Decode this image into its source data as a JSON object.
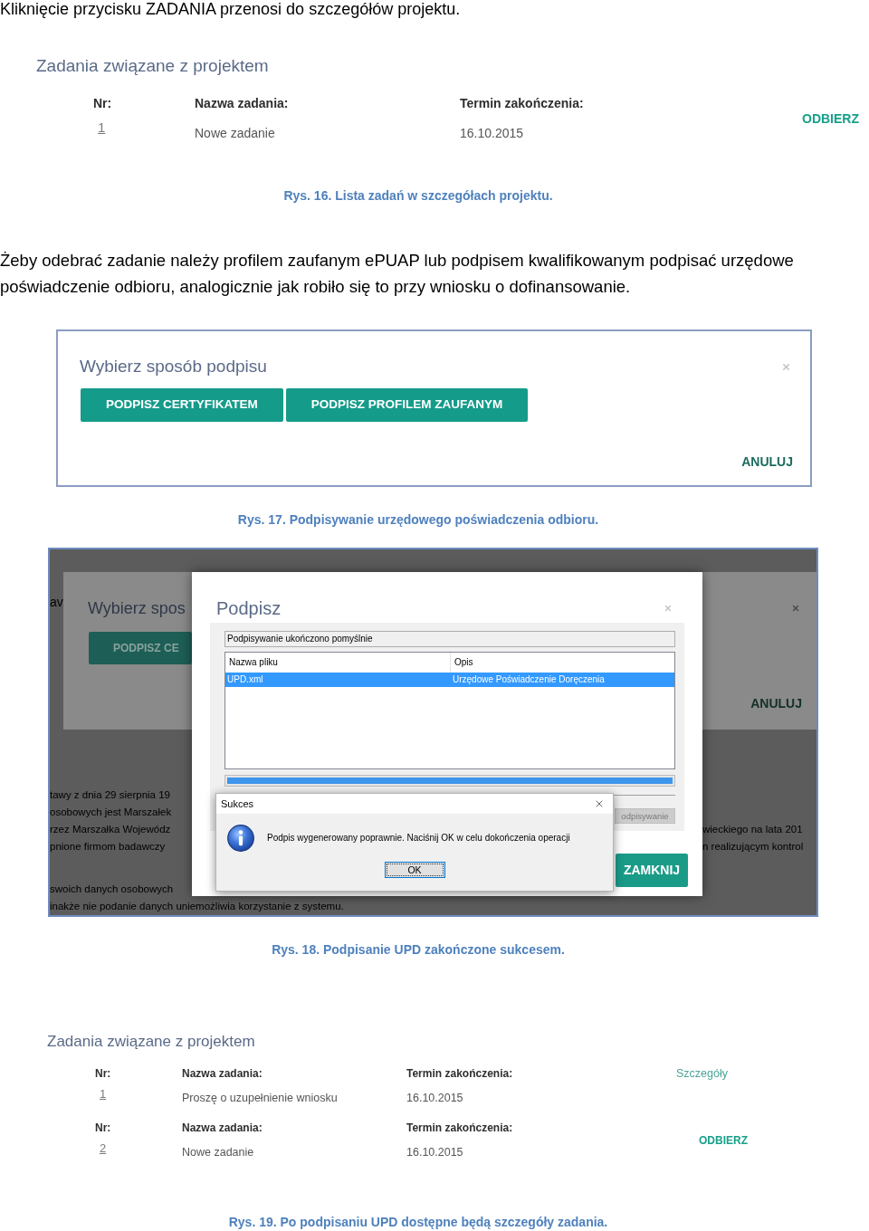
{
  "intro": "Kliknięcie przycisku ZADANIA przenosi do szczegółów projektu.",
  "figure_16": {
    "task_list": {
      "title": "Zadania związane z projektem",
      "tasks": [
        {
          "number_label": "Nr:",
          "number": "1",
          "name_label": "Nazwa zadania:",
          "name": "Nowe zadanie",
          "deadline_label": "Termin zakończenia:",
          "deadline": "16.10.2015",
          "action": {
            "kind": "button",
            "label": "ODBIERZ"
          }
        }
      ]
    },
    "caption": "Rys. 16. Lista zadań w szczegółach projektu."
  },
  "paragraph": "Żeby odebrać zadanie należy profilem zaufanym ePUAP lub podpisem kwalifikowanym podpisać urzędowe poświadczenie odbioru, analogicznie jak robiło się to przy wniosku o dofinansowanie.",
  "figure_17": {
    "dialog": {
      "title": "Wybierz sposób podpisu",
      "buttons": [
        "PODPISZ CERTYFIKATEM",
        "PODPISZ PROFILEM ZAUFANYM"
      ],
      "cancel": "ANULUJ"
    },
    "caption": "Rys. 17. Podpisywanie urzędowego poświadczenia odbioru."
  },
  "figure_18": {
    "background": {
      "edge_text": "av",
      "dimmed_dialog": {
        "title": "Wybierz spos",
        "button": "PODPISZ CE",
        "cancel": "ANULUJ"
      },
      "paragraphs": [
        {
          "lines": [
            {
              "left": "tawy z dnia 29 sierpnia 19"
            },
            {
              "left": "osobowych jest Marszałek"
            },
            {
              "left": "rzez Marszałka Wojewódz",
              "right": "wieckiego na lata 201"
            },
            {
              "left": "pnione firmom badawczy",
              "right": "n realizującym kontrol"
            }
          ]
        },
        {
          "lines": [
            {
              "left": "swoich danych osobowych"
            },
            {
              "left": "inakże nie podanie danych uniemożliwia korzystanie z systemu."
            }
          ]
        }
      ]
    },
    "sign_dialog": {
      "title": "Podpisz",
      "status": "Podpisywanie ukończono pomyślnie",
      "columns": [
        "Nazwa pliku",
        "Opis"
      ],
      "rows": [
        {
          "file": "UPD.xml",
          "description": "Urzędowe Poświadczenie Doręczenia",
          "selected": true
        }
      ],
      "progress": {
        "level": 1
      },
      "sign_button": {
        "label": "odpisywanie",
        "disabled": true
      },
      "close_button": "ZAMKNIJ"
    },
    "message_box": {
      "title": "Sukces",
      "message": "Podpis wygenerowany poprawnie. Naciśnij OK w celu dokończenia operacji",
      "ok_button": {
        "label": "OK",
        "focused": true
      }
    },
    "caption": "Rys. 18. Podpisanie UPD zakończone sukcesem."
  },
  "figure_19": {
    "task_list": {
      "title": "Zadania związane z projektem",
      "tasks": [
        {
          "number_label": "Nr:",
          "number": "1",
          "name_label": "Nazwa zadania:",
          "name": "Proszę o uzupełnienie wniosku",
          "deadline_label": "Termin zakończenia:",
          "deadline": "16.10.2015",
          "action": {
            "kind": "link",
            "label": "Szczegóły"
          }
        },
        {
          "number_label": "Nr:",
          "number": "2",
          "name_label": "Nazwa zadania:",
          "name": "Nowe zadanie",
          "deadline_label": "Termin zakończenia:",
          "deadline": "16.10.2015",
          "action": {
            "kind": "button",
            "label": "ODBIERZ"
          }
        }
      ]
    },
    "caption": "Rys. 19. Po podpisaniu UPD dostępne będą szczegóły zadania."
  }
}
